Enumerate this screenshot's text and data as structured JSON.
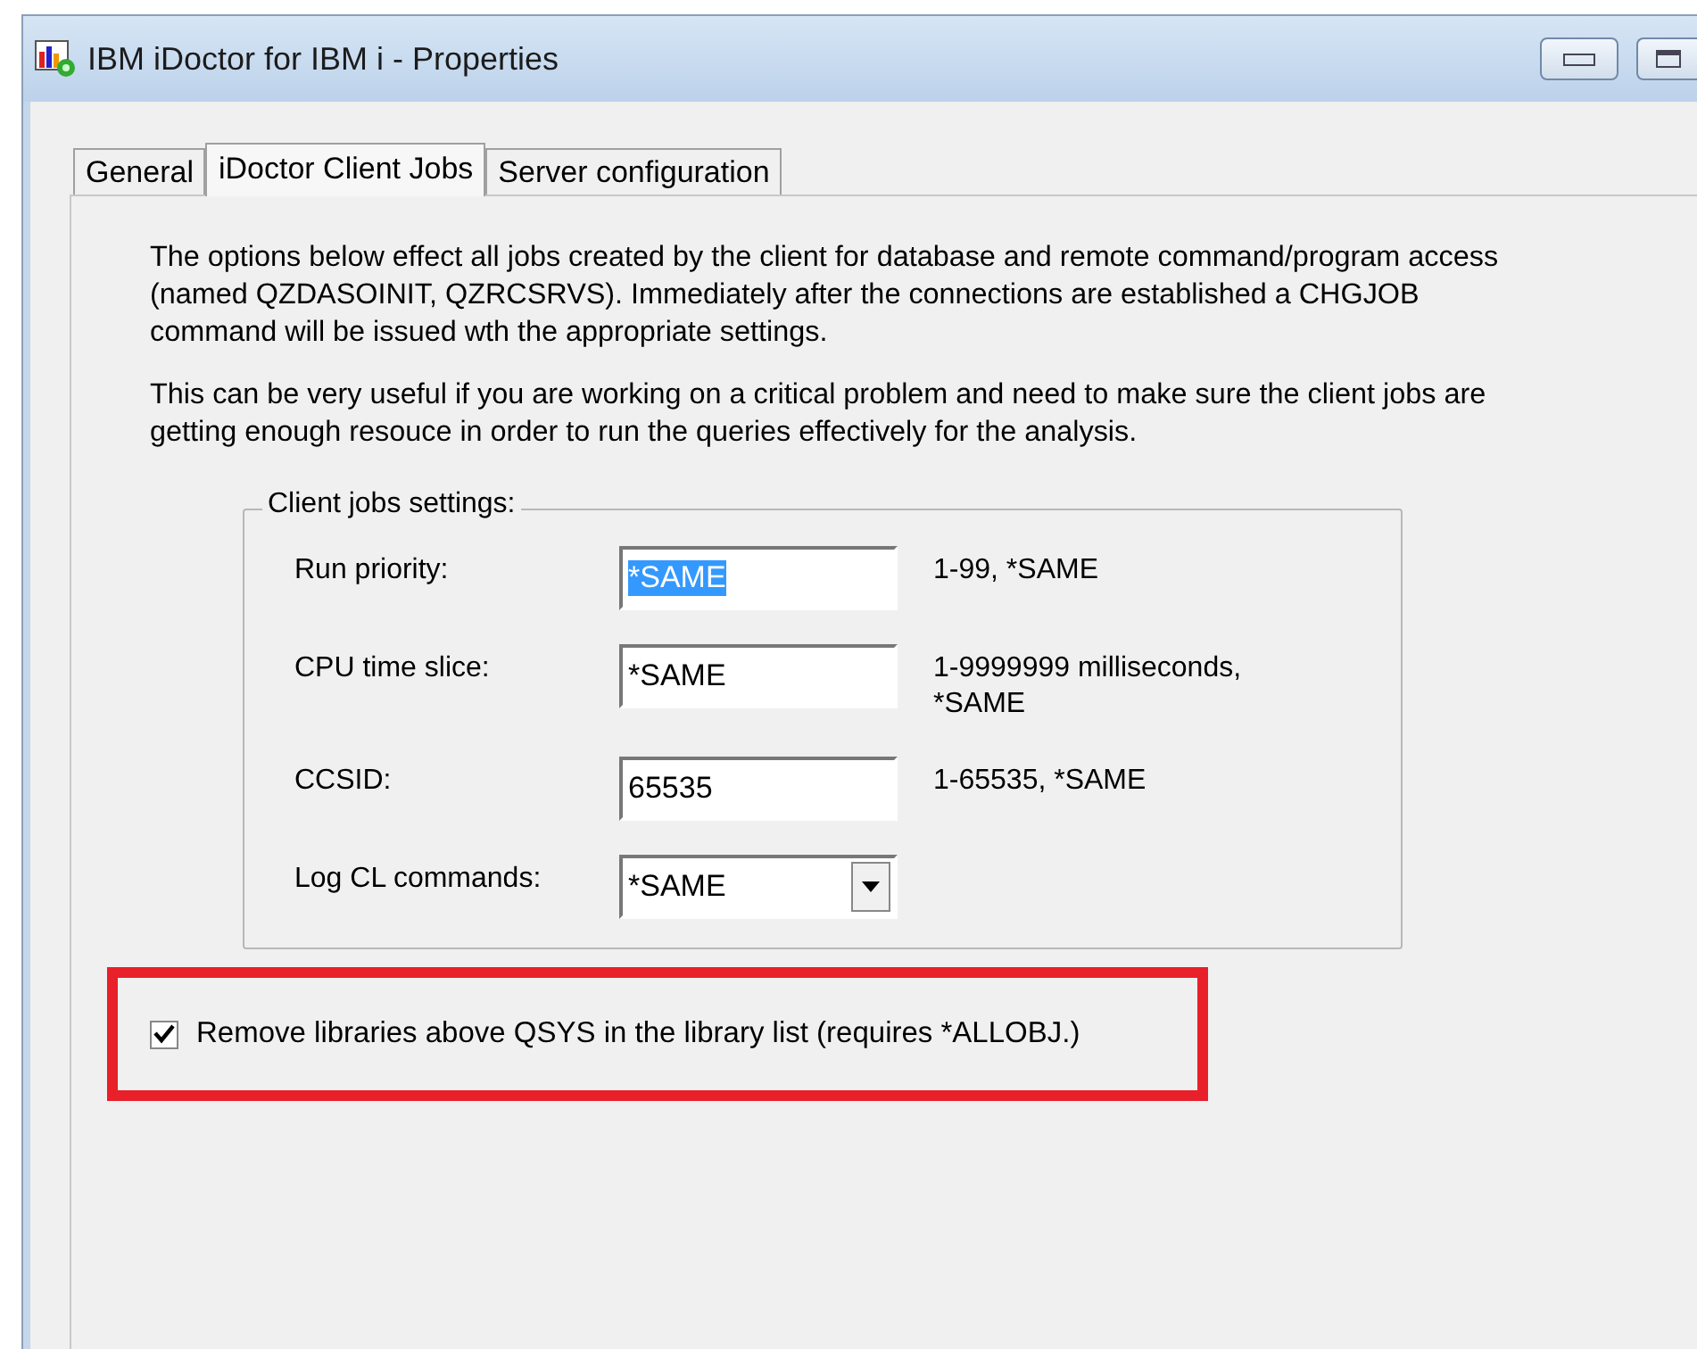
{
  "window": {
    "title": "IBM iDoctor for IBM i - Properties"
  },
  "tabs": [
    {
      "label": "General",
      "selected": false
    },
    {
      "label": "iDoctor Client Jobs",
      "selected": true
    },
    {
      "label": "Server configuration",
      "selected": false
    }
  ],
  "description": [
    "The options below effect all jobs created by the client for database and remote command/program access (named QZDASOINIT, QZRCSRVS).  Immediately after the connections are established a CHGJOB command will be issued wth the appropriate settings.",
    "This can be very useful if you are working on a critical problem and need to make sure the client jobs are getting enough resouce in order to run the queries effectively for the analysis."
  ],
  "settings_group": {
    "title": "Client jobs settings:",
    "fields": [
      {
        "kind": "text",
        "label": "Run priority:",
        "value": "*SAME",
        "selected": true,
        "hint": "1-99, *SAME"
      },
      {
        "kind": "text",
        "label": "CPU time slice:",
        "value": "*SAME",
        "selected": false,
        "hint": "1-9999999 milliseconds, *SAME"
      },
      {
        "kind": "text",
        "label": "CCSID:",
        "value": "65535",
        "selected": false,
        "hint": "1-65535, *SAME"
      },
      {
        "kind": "dropdown",
        "label": "Log CL commands:",
        "value": "*SAME",
        "selected": false
      }
    ]
  },
  "remove_libraries": {
    "label": "Remove libraries above QSYS in the library list (requires *ALLOBJ.)",
    "checked": true,
    "highlighted": true
  }
}
